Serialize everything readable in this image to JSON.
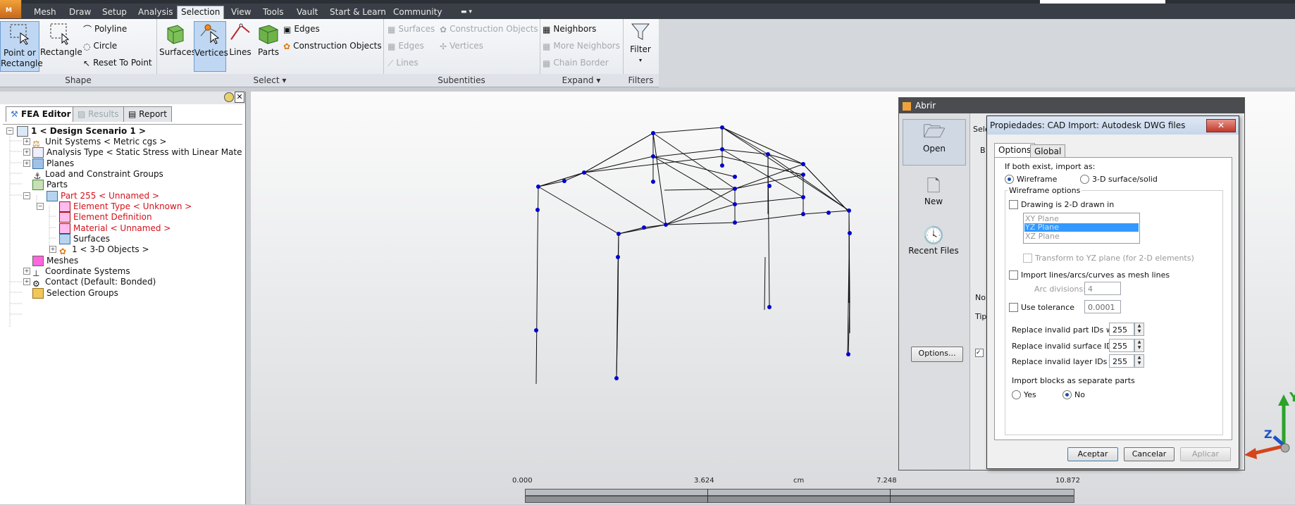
{
  "app": {
    "menu_letter": "M"
  },
  "menubar": {
    "tabs": [
      "Mesh",
      "Draw",
      "Setup",
      "Analysis",
      "Selection",
      "View",
      "Tools",
      "Vault",
      "Start & Learn",
      "Community"
    ],
    "active": "Selection"
  },
  "ribbon": {
    "shape": {
      "title": "Shape",
      "point_or_rect_1": "Point or",
      "point_or_rect_2": "Rectangle",
      "rectangle": "Rectangle",
      "polyline": "Polyline",
      "circle": "Circle",
      "reset_to_point": "Reset To Point"
    },
    "select": {
      "title": "Select",
      "surfaces": "Surfaces",
      "vertices": "Vertices",
      "lines": "Lines",
      "parts": "Parts",
      "edges": "Edges",
      "construction_objects": "Construction Objects"
    },
    "subentities": {
      "title": "Subentities",
      "surfaces": "Surfaces",
      "edges": "Edges",
      "lines": "Lines",
      "construction_objects": "Construction Objects",
      "vertices": "Vertices"
    },
    "expand": {
      "title": "Expand",
      "neighbors": "Neighbors",
      "more_neighbors": "More Neighbors",
      "chain_border": "Chain Border"
    },
    "filters": {
      "title": "Filters",
      "filter": "Filter"
    }
  },
  "left_pane": {
    "tabs": [
      "FEA Editor",
      "Results",
      "Report"
    ],
    "tree": [
      {
        "label": "1 < Design Scenario 1 >"
      },
      {
        "label": "Unit Systems < Metric cgs >"
      },
      {
        "label": "Analysis Type < Static Stress with Linear Material Mc"
      },
      {
        "label": "Planes"
      },
      {
        "label": "Load and Constraint Groups"
      },
      {
        "label": "Parts"
      },
      {
        "label": "Part 255 < Unnamed >"
      },
      {
        "label": "Element Type < Unknown >"
      },
      {
        "label": "Element Definition"
      },
      {
        "label": "Material < Unnamed >"
      },
      {
        "label": "Surfaces"
      },
      {
        "label": "1 < 3-D Objects >"
      },
      {
        "label": "Meshes"
      },
      {
        "label": "Coordinate Systems"
      },
      {
        "label": "Contact (Default: Bonded)"
      },
      {
        "label": "Selection Groups"
      }
    ]
  },
  "dialog_abrir": {
    "title": "Abrir",
    "open": "Open",
    "new": "New",
    "recent_files": "Recent Files",
    "options_btn": "Options...",
    "frag_sel": "Sele",
    "frag_b": "B",
    "frag_no": "No",
    "frag_tip": "Tip"
  },
  "dialog_props": {
    "title": "Propiedades: CAD Import:  Autodesk DWG files",
    "close": "✕",
    "tabs": [
      "Options",
      "Global"
    ],
    "if_both": "If both exist, import as:",
    "wireframe": "Wireframe",
    "surface_solid": "3-D surface/solid",
    "wireframe_options": "Wireframe options",
    "drawing_2d": "Drawing is 2-D drawn in",
    "planes": [
      "XY Plane",
      "YZ Plane",
      "XZ Plane"
    ],
    "selected_plane": "YZ Plane",
    "transform": "Transform to YZ plane (for 2-D elements)",
    "import_lines": "Import lines/arcs/curves as mesh lines",
    "arc_divisions_label": "Arc divisions:",
    "arc_divisions": "4",
    "use_tolerance": "Use tolerance",
    "tolerance": "0.0001",
    "replace_part": "Replace invalid part IDs with:",
    "replace_part_val": "255",
    "replace_surface": "Replace invalid surface IDs with:",
    "replace_surface_val": "255",
    "replace_layer": "Replace invalid layer IDs with:",
    "replace_layer_val": "255",
    "import_blocks": "Import blocks as separate parts",
    "yes": "Yes",
    "no": "No",
    "aceptar": "Aceptar",
    "cancelar": "Cancelar",
    "aplicar": "Aplicar"
  },
  "scale": {
    "labels": [
      "0.000",
      "3.624",
      "cm",
      "7.248",
      "10.872"
    ]
  },
  "triad": {
    "y": "Y",
    "z": "Z"
  },
  "colors": {
    "accent": "#3a70c8",
    "node": "#0000cc",
    "error_red": "#d4101a"
  }
}
